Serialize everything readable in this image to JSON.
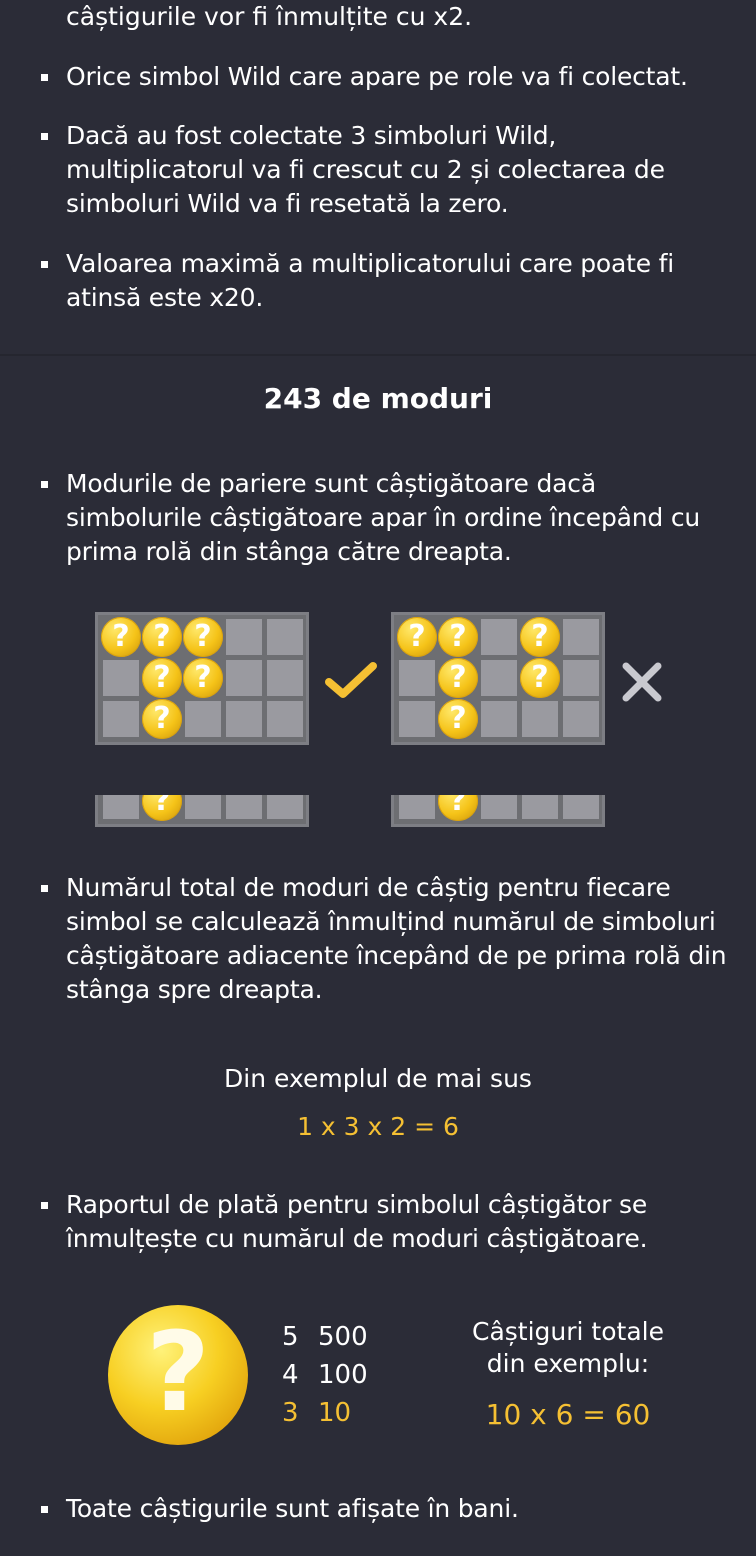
{
  "rules": {
    "top_fragment": "câștigurile vor fi înmulțite cu x2.",
    "wild_collect": "Orice simbol Wild care apare pe role va fi colectat.",
    "wild_three": "Dacă au fost colectate 3 simboluri Wild, multiplicatorul va fi crescut cu 2 și colectarea de simboluri Wild va fi resetată la zero.",
    "max_multiplier": "Valoarea maximă a multiplicatorului care poate fi atinsă este x20."
  },
  "ways": {
    "title": "243 de moduri",
    "rule_order": "Modurile de pariere sunt câștigătoare dacă simbolurile câștigătoare apar în ordine începând cu prima rolă din stânga către dreapta.",
    "rule_count": "Numărul total de moduri de câștig pentru fiecare simbol se calculează înmulțind numărul de simboluri câștigătoare adiacente începând de pe prima rolă din stânga spre dreapta.",
    "example_label": "Din exemplul de mai sus",
    "example_formula": "1 x 3 x 2 = 6",
    "rule_payout": "Raportul de plată pentru simbolul câștigător se înmulțește cu numărul de moduri câștigătoare.",
    "valid_icon": "checkmark-icon",
    "invalid_icon": "cross-icon",
    "symbol_icon": "question-coin-icon"
  },
  "paytable": [
    {
      "count": "5",
      "value": "500"
    },
    {
      "count": "4",
      "value": "100"
    },
    {
      "count": "3",
      "value": "10"
    }
  ],
  "total_win": {
    "label_line1": "Câștiguri totale",
    "label_line2": "din exemplu:",
    "formula": "10 x 6 = 60"
  },
  "footer_rule": "Toate câștigurile sunt afișate în bani.",
  "colors": {
    "background": "#2b2c37",
    "accent_gold": "#f5c033",
    "cell": "#9a9aa0"
  }
}
